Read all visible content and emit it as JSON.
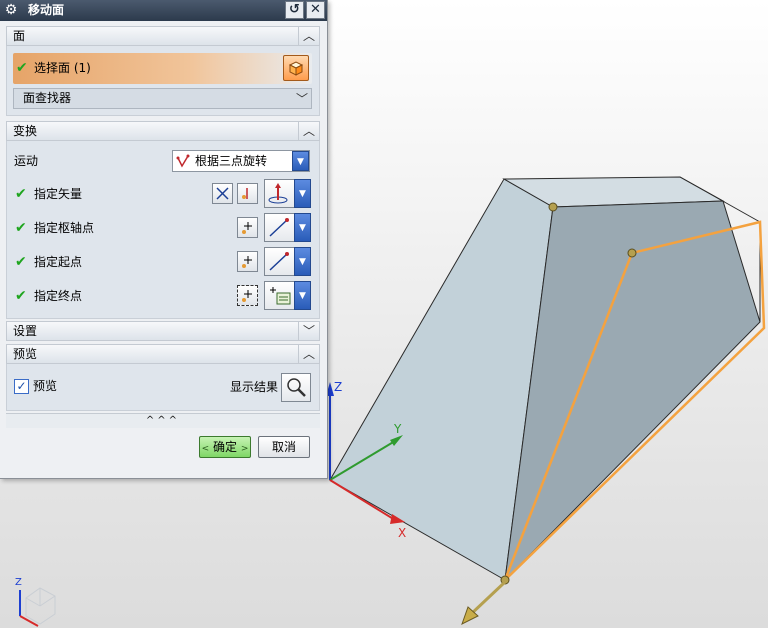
{
  "dialog": {
    "title": "移动面",
    "sections": {
      "face": {
        "label": "面"
      },
      "transform": {
        "label": "变换"
      },
      "settings": {
        "label": "设置"
      },
      "preview": {
        "label": "预览"
      }
    },
    "select_face": {
      "label": "选择面 (1)"
    },
    "face_finder": {
      "label": "面查找器"
    },
    "motion": {
      "label": "运动",
      "value": "根据三点旋转"
    },
    "rows": {
      "vector": "指定矢量",
      "pivot": "指定枢轴点",
      "start": "指定起点",
      "end": "指定终点"
    },
    "preview_checkbox": {
      "label": "预览",
      "checked": true
    },
    "show_result": {
      "label": "显示结果"
    },
    "more_glyph": "^^^",
    "ok": {
      "label": "确定",
      "arrow_left": "<",
      "arrow_right": ">"
    },
    "cancel": {
      "label": "取消"
    }
  },
  "viewport": {
    "axis_labels": {
      "z": "Z",
      "y": "Y",
      "x": "X"
    },
    "mini_triad": {
      "z": "Z"
    },
    "colors": {
      "solid_light": "#c4d2da",
      "solid_dark": "#9aaab4",
      "highlight": "#f4a23f",
      "x_axis": "#d62a2a",
      "y_axis": "#2f9b2f",
      "z_axis": "#1d3fd1",
      "point": "#b09a4a"
    }
  }
}
